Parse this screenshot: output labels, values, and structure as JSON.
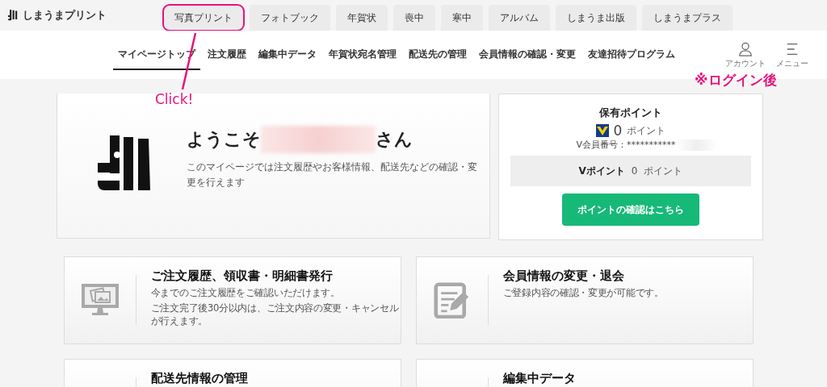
{
  "site": {
    "logo": "しまうまプリント"
  },
  "service_tabs": [
    {
      "label": "写真プリント",
      "highlighted": true
    },
    {
      "label": "フォトブック",
      "highlighted": false
    },
    {
      "label": "年賀状",
      "highlighted": false
    },
    {
      "label": "喪中",
      "highlighted": false
    },
    {
      "label": "寒中",
      "highlighted": false
    },
    {
      "label": "アルバム",
      "highlighted": false
    },
    {
      "label": "しまうま出版",
      "highlighted": false
    },
    {
      "label": "しまうまプラス",
      "highlighted": false
    }
  ],
  "mypage_nav": [
    {
      "label": "マイページトップ",
      "selected": true
    },
    {
      "label": "注文履歴",
      "selected": false
    },
    {
      "label": "編集中データ",
      "selected": false
    },
    {
      "label": "年賀状宛名管理",
      "selected": false
    },
    {
      "label": "配送先の管理",
      "selected": false
    },
    {
      "label": "会員情報の確認・変更",
      "selected": false
    },
    {
      "label": "友達招待プログラム",
      "selected": false
    }
  ],
  "header_icons": [
    {
      "kind": "account",
      "label": "アカウント"
    },
    {
      "kind": "menu",
      "label": "メニュー"
    }
  ],
  "annotations": {
    "callout": "Click!",
    "note": "※ログイン後"
  },
  "welcome": {
    "greeting_prefix": "ようこそ",
    "name_redacted": true,
    "greeting_suffix": "さん",
    "description": "このマイページでは注文履歴やお客様情報、配送先などの確認・変更を行えます"
  },
  "points": {
    "title": "保有ポイント",
    "amount": "0",
    "unit": "ポイント",
    "member_label": "V会員番号：",
    "member_number": "***********",
    "member_number_redacted": true,
    "v_label": "Vポイント",
    "v_amount": "0",
    "v_unit": "ポイント",
    "button": "ポイントの確認はこちら"
  },
  "menu_cards": [
    {
      "kind": "history",
      "title": "ご注文履歴、領収書・明細書発行",
      "description": [
        "今までのご注文履歴をご確認いただけます。",
        "ご注文完了後30分以内は、ご注文内容の変更・キャンセルが行えます。"
      ]
    },
    {
      "kind": "member",
      "title": "会員情報の変更・退会",
      "description": [
        "ご登録内容の確認・変更が可能です。"
      ]
    },
    {
      "kind": "delivery",
      "title": "配送先情報の管理"
    },
    {
      "kind": "editing",
      "title": "編集中データ"
    }
  ]
}
